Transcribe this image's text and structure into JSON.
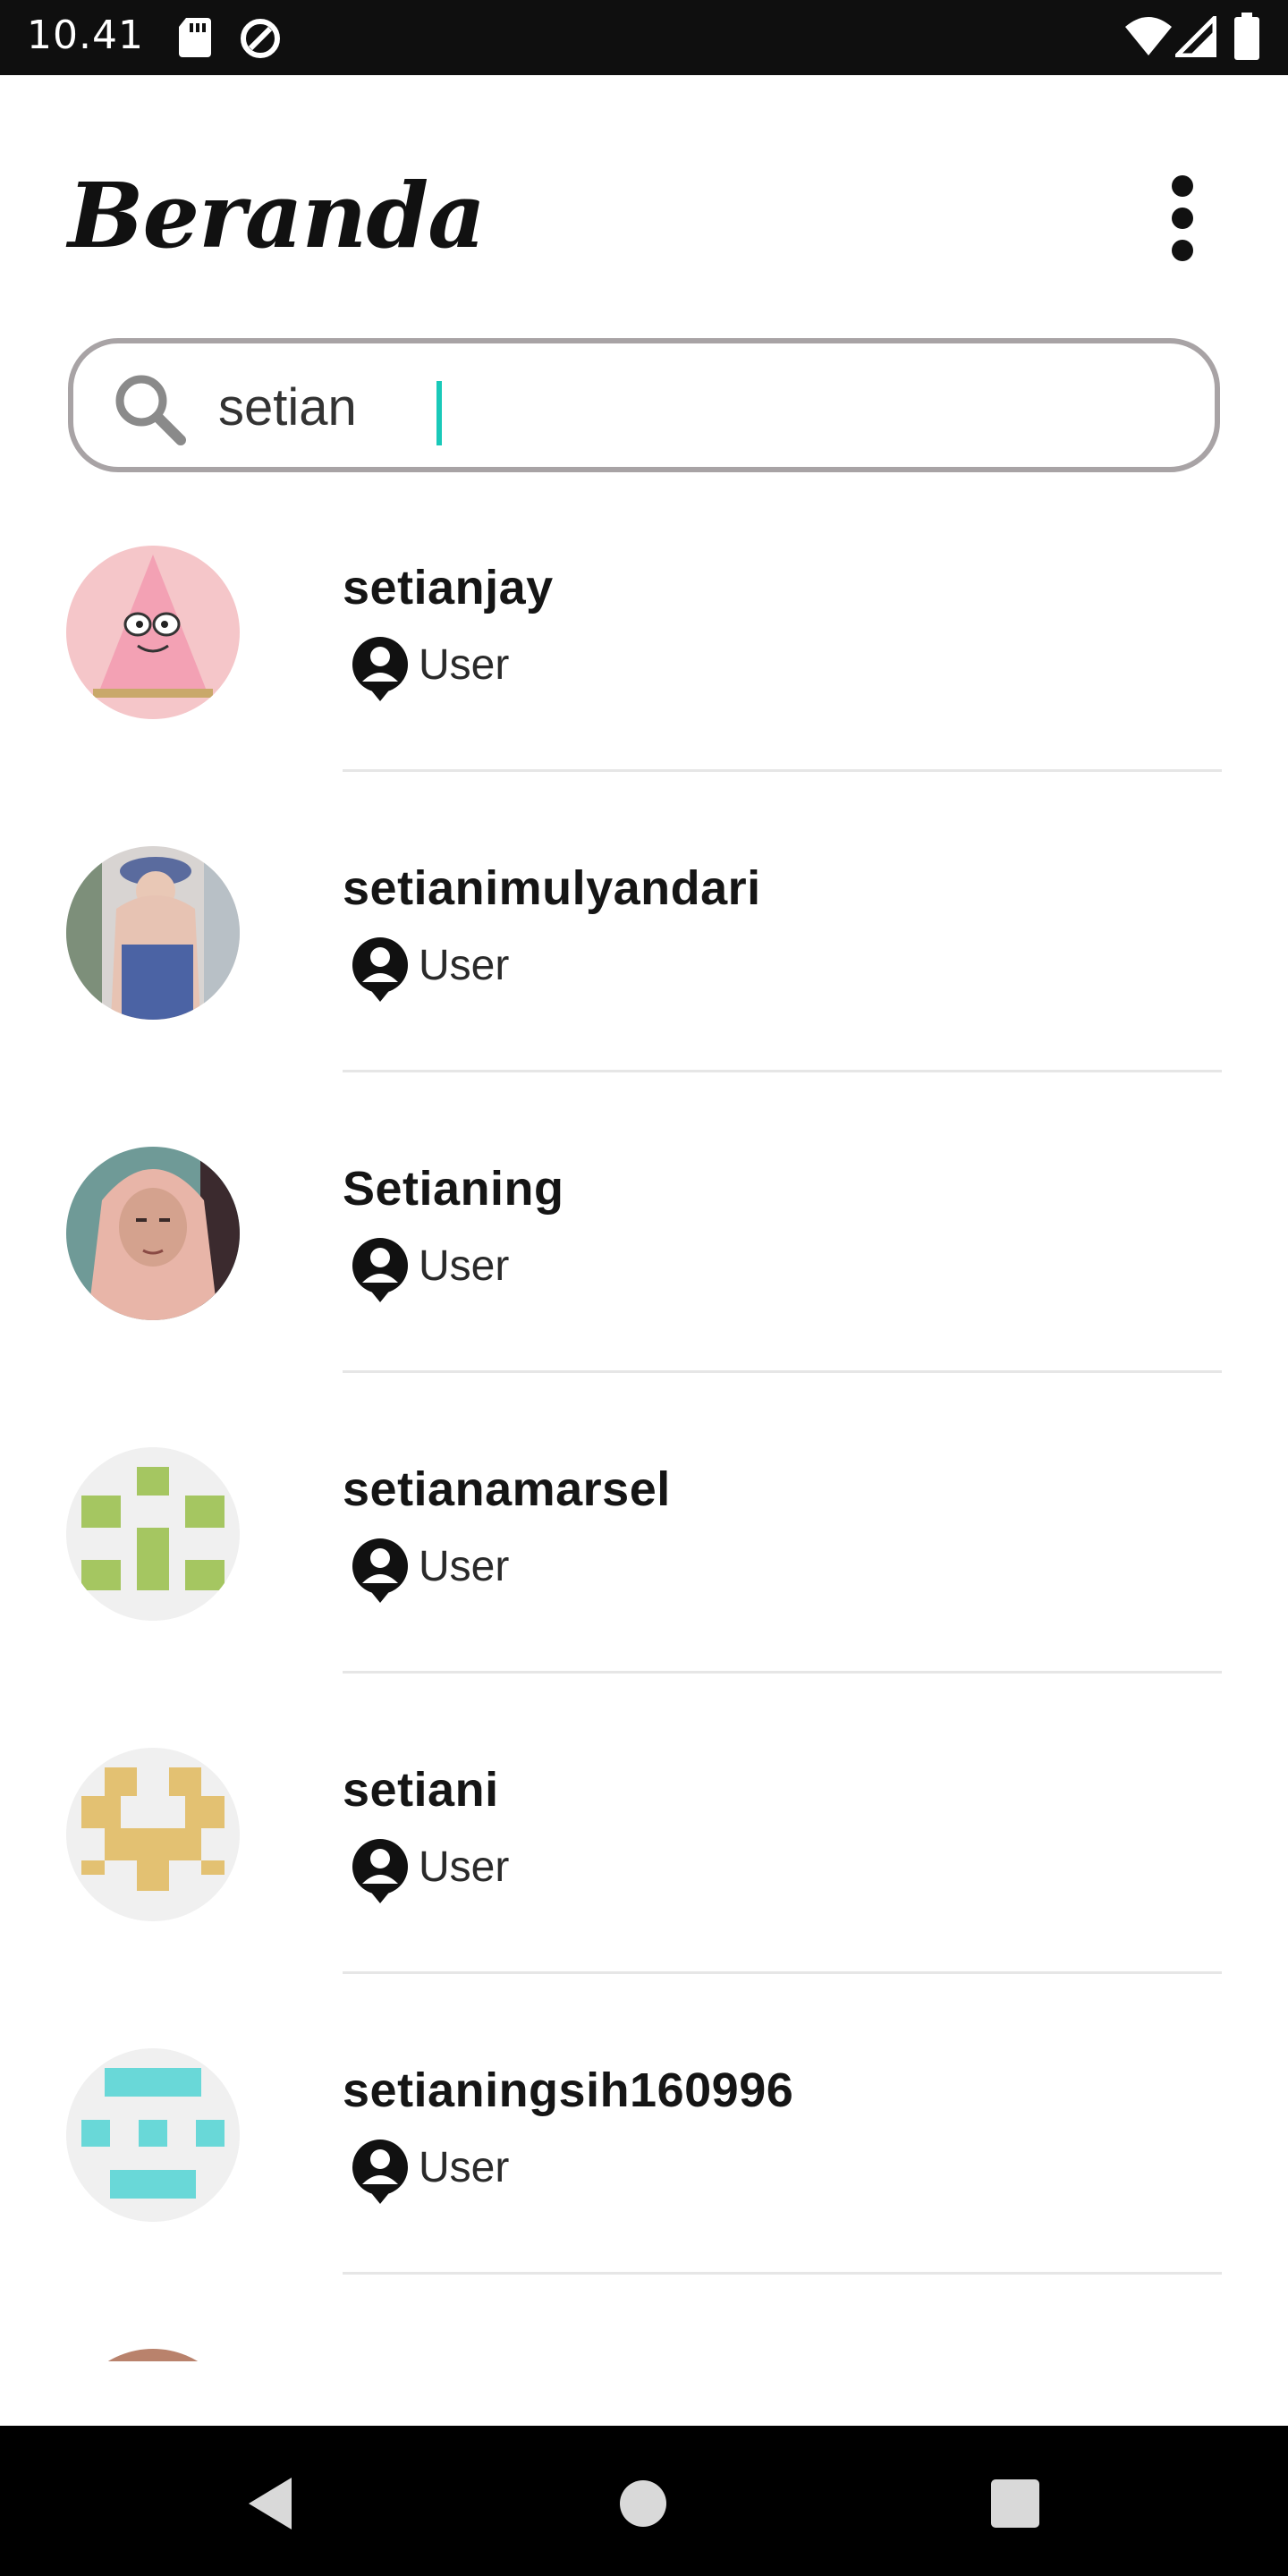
{
  "status_bar": {
    "time": "10.41",
    "icons": [
      "sd-card-icon",
      "data-saver-icon",
      "wifi-icon",
      "cell-signal-icon",
      "battery-icon"
    ]
  },
  "header": {
    "title": "Beranda",
    "menu_icon": "more-vertical-icon"
  },
  "search": {
    "icon": "search-icon",
    "value": "setian",
    "accent_color": "#19c9b9"
  },
  "users": [
    {
      "name": "setianjay",
      "role": "User",
      "avatar": "patrick-photo"
    },
    {
      "name": "setianimulyandari",
      "role": "User",
      "avatar": "person-photo"
    },
    {
      "name": "Setianing",
      "role": "User",
      "avatar": "person-photo"
    },
    {
      "name": "setianamarsel",
      "role": "User",
      "avatar": "identicon",
      "avatar_color": "#a5c661"
    },
    {
      "name": "setiani",
      "role": "User",
      "avatar": "identicon",
      "avatar_color": "#e3c172"
    },
    {
      "name": "setianingsih160996",
      "role": "User",
      "avatar": "identicon",
      "avatar_color": "#69d8d8"
    }
  ],
  "nav_bar": {
    "buttons": [
      "back-icon",
      "home-icon",
      "recents-icon"
    ]
  }
}
